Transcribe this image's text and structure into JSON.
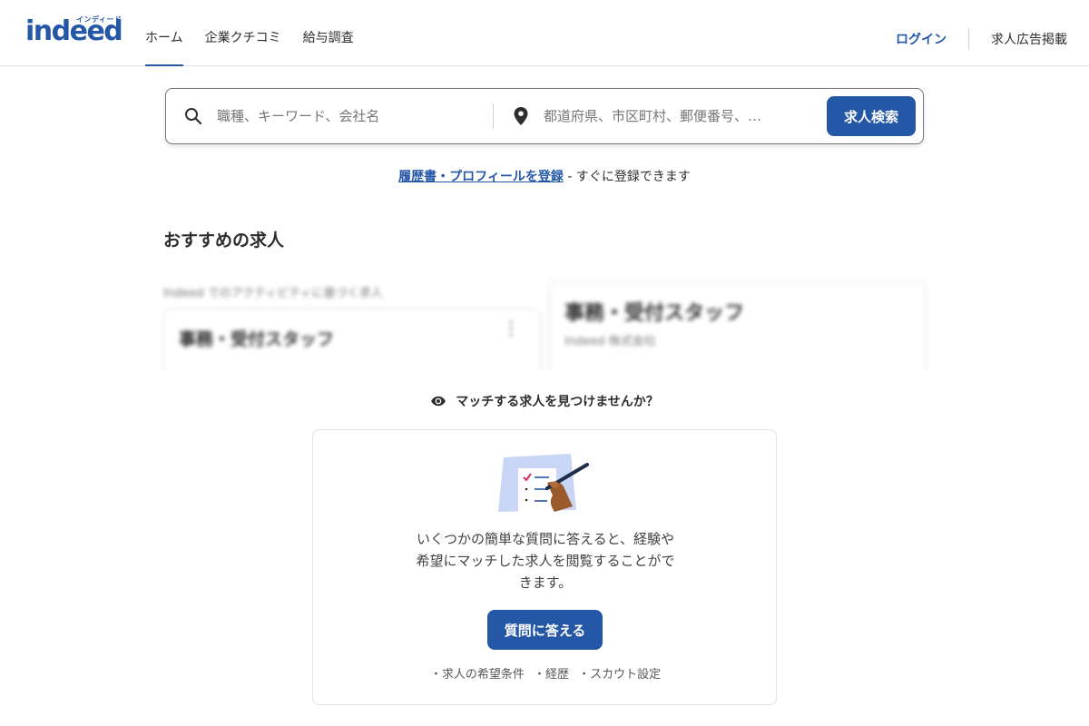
{
  "header": {
    "logo_text": "indeed",
    "logo_kana": "インディード",
    "nav": [
      {
        "label": "ホーム",
        "active": true
      },
      {
        "label": "企業クチコミ",
        "active": false
      },
      {
        "label": "給与調査",
        "active": false
      }
    ],
    "login_label": "ログイン",
    "post_job_label": "求人広告掲載"
  },
  "search": {
    "what_placeholder": "職種、キーワード、会社名",
    "where_placeholder": "都道府県、市区町村、郵便番号、…",
    "button_label": "求人検索",
    "what_icon": "search-icon",
    "where_icon": "location-pin-icon"
  },
  "resume": {
    "link_text": "履歴書・プロフィールを登録",
    "suffix": " - すぐに登録できます"
  },
  "recommended": {
    "title": "おすすめの求人",
    "activity_label": "Indeed でのアクティビティに基づく求人",
    "cards": [
      {
        "job_title": "事務・受付スタッフ"
      },
      {
        "job_title": "事務・受付スタッフ",
        "company": "Indeed 株式会社"
      }
    ]
  },
  "match": {
    "heading": "マッチする求人を見つけませんか？",
    "heading_icon": "eye-icon",
    "body": "いくつかの簡単な質問に答えると、経験や希望にマッチした求人を閲覧することができます。",
    "button_label": "質問に答える",
    "bullets": [
      "・求人の希望条件",
      "・経歴",
      "・スカウト設定"
    ]
  },
  "colors": {
    "brand": "#2557a7",
    "text": "#2d2d2d",
    "border": "#e4e2e0"
  }
}
